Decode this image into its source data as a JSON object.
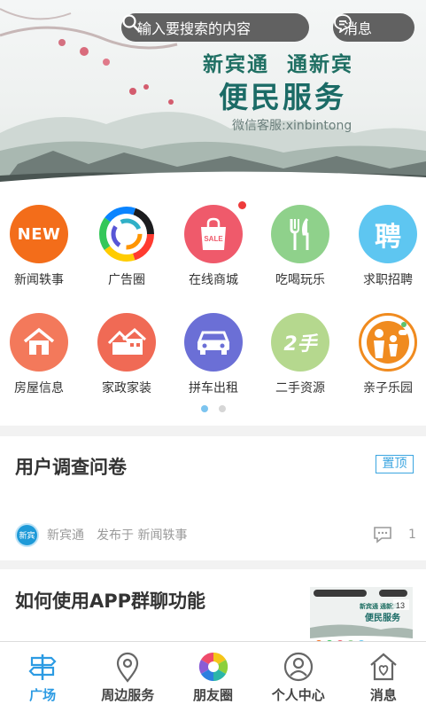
{
  "search": {
    "placeholder": "输入要搜索的内容",
    "icon": "search-icon"
  },
  "header": {
    "message_label": "消息",
    "message_icon": "chat-bubble-icon"
  },
  "banner": {
    "slogan_line1": "新宾通  通新宾",
    "slogan_line2": "便民服务",
    "slogan_line3": "微信客服:xinbintong"
  },
  "categories": [
    {
      "label": "新闻轶事",
      "icon": "news-icon",
      "icon_text": "NEW",
      "color": "#f36d1a"
    },
    {
      "label": "广告圈",
      "icon": "rainbow-circle-icon",
      "icon_text": "",
      "color": "#ffffff"
    },
    {
      "label": "在线商城",
      "icon": "shopping-bag-icon",
      "icon_text": "SALE",
      "color": "#ef5a6b",
      "badge": true
    },
    {
      "label": "吃喝玩乐",
      "icon": "fork-knife-icon",
      "icon_text": "",
      "color": "#8fd18b"
    },
    {
      "label": "求职招聘",
      "icon": "recruit-icon",
      "icon_text": "聘",
      "color": "#5ec6f1"
    },
    {
      "label": "房屋信息",
      "icon": "house-icon",
      "icon_text": "",
      "color": "#f3795b"
    },
    {
      "label": "家政家装",
      "icon": "houses-icon",
      "icon_text": "",
      "color": "#f06a55"
    },
    {
      "label": "拼车出租",
      "icon": "car-icon",
      "icon_text": "",
      "color": "#6b6fd6"
    },
    {
      "label": "二手资源",
      "icon": "second-hand-icon",
      "icon_text": "2手",
      "color": "#b5d88e"
    },
    {
      "label": "亲子乐园",
      "icon": "family-icon",
      "icon_text": "",
      "color": "#f08b1f"
    }
  ],
  "pager": {
    "pages": 2,
    "current": 1,
    "active_color": "#7cc4ef",
    "inactive_color": "#d6d6d6"
  },
  "feed": [
    {
      "title": "用户调查问卷",
      "pin_label": "置顶",
      "author": "新宾通",
      "published_in": "发布于 新闻轶事",
      "comment_count": "1",
      "avatar_text": "新宾"
    },
    {
      "title": "如何使用APP群聊功能",
      "thumb_badge": "13"
    }
  ],
  "tabs": [
    {
      "label": "广场",
      "icon": "signpost-icon",
      "active": true
    },
    {
      "label": "周边服务",
      "icon": "location-pin-icon",
      "active": false
    },
    {
      "label": "朋友圈",
      "icon": "aperture-icon",
      "active": false
    },
    {
      "label": "个人中心",
      "icon": "user-icon",
      "active": false
    },
    {
      "label": "消息",
      "icon": "home-heart-icon",
      "active": false
    }
  ],
  "colors": {
    "accent": "#2c9be3",
    "banner_text": "#1b6b66"
  }
}
